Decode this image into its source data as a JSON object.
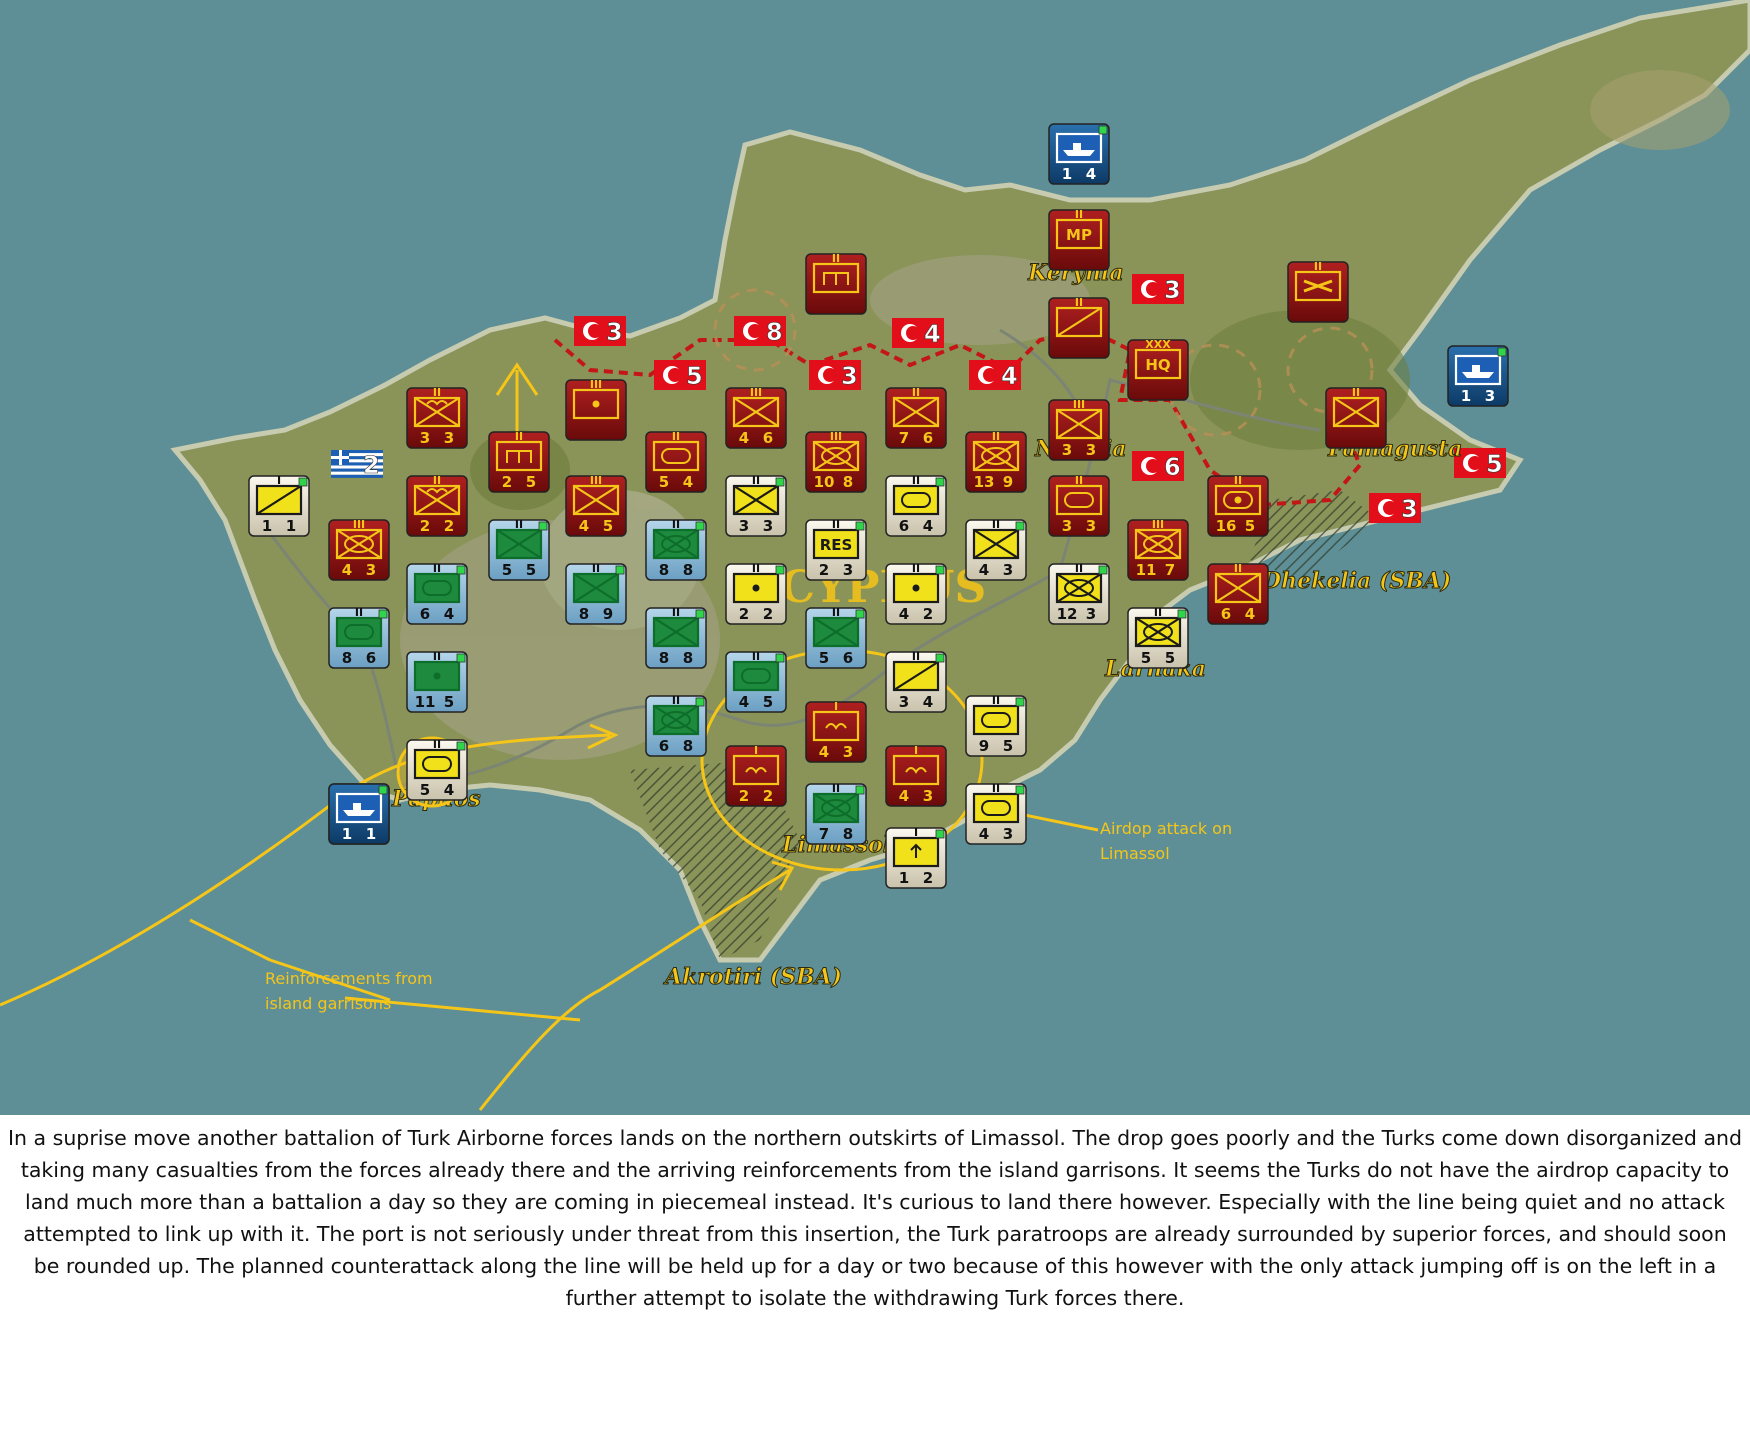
{
  "map": {
    "island_label": "CYPRUS",
    "places": {
      "kyrenia": "Kerynia",
      "nicosia": "Nicosia",
      "famagusta": "Famagusta",
      "dhekelia": "Dhekelia (SBA)",
      "larnaca": "Larnaka",
      "paphos": "Paphos",
      "limassol": "Limassol",
      "akrotiri": "Akrotiri (SBA)"
    },
    "annotations": {
      "airdrop_line1": "Airdop attack on",
      "airdrop_line2": "Limassol",
      "reinf_line1": "Reinforcements from",
      "reinf_line2": "island garrisons"
    },
    "colors": {
      "sea": "#5e8f96",
      "land": "#8a9358",
      "turk_counter": "#8e1010",
      "greek_counter": "#8dbad6",
      "cypriot_counter": "#ece6d4",
      "naval_counter": "#17558e",
      "annotation": "#f5c518",
      "place_label": "#f5c518"
    },
    "flags": [
      {
        "n": "3",
        "icon": "turkish-flag-icon"
      },
      {
        "n": "8",
        "icon": "turkish-flag-icon"
      },
      {
        "n": "4",
        "icon": "turkish-flag-icon"
      },
      {
        "n": "5",
        "icon": "turkish-flag-icon"
      },
      {
        "n": "3",
        "icon": "turkish-flag-icon"
      },
      {
        "n": "4",
        "icon": "turkish-flag-icon"
      },
      {
        "n": "3",
        "icon": "turkish-flag-icon"
      },
      {
        "n": "6",
        "icon": "turkish-flag-icon"
      },
      {
        "n": "5",
        "icon": "turkish-flag-icon"
      },
      {
        "n": "3",
        "icon": "turkish-flag-icon"
      },
      {
        "n": "2",
        "icon": "greek-flag-icon"
      }
    ],
    "units": [
      {
        "side": "turk",
        "size": "II",
        "sym": "MP",
        "a": "",
        "d": ""
      },
      {
        "side": "turk",
        "size": "II",
        "sym": "engineer",
        "a": "",
        "d": ""
      },
      {
        "side": "turk",
        "size": "II",
        "sym": "recon",
        "a": "",
        "d": ""
      },
      {
        "side": "turk",
        "size": "II",
        "sym": "helo",
        "a": "",
        "d": ""
      },
      {
        "side": "turk",
        "size": "XXX",
        "sym": "HQ",
        "a": "",
        "d": ""
      },
      {
        "side": "turk",
        "size": "II",
        "sym": "para-inf",
        "a": "3",
        "d": "3"
      },
      {
        "side": "turk",
        "size": "II",
        "sym": "engineer",
        "a": "2",
        "d": "5"
      },
      {
        "side": "turk",
        "size": "III",
        "sym": "artillery",
        "a": "",
        "d": ""
      },
      {
        "side": "turk",
        "size": "III",
        "sym": "inf",
        "a": "4",
        "d": "6"
      },
      {
        "side": "turk",
        "size": "II",
        "sym": "inf",
        "a": "7",
        "d": "6"
      },
      {
        "side": "turk",
        "size": "III",
        "sym": "inf",
        "a": "3",
        "d": "3"
      },
      {
        "side": "turk",
        "size": "II",
        "sym": "inf",
        "a": "",
        "d": ""
      },
      {
        "side": "turk",
        "size": "II",
        "sym": "para-inf",
        "a": "2",
        "d": "2"
      },
      {
        "side": "turk",
        "size": "II",
        "sym": "armor",
        "a": "5",
        "d": "4"
      },
      {
        "side": "turk",
        "size": "III",
        "sym": "mech-inf",
        "a": "10",
        "d": "8"
      },
      {
        "side": "turk",
        "size": "II",
        "sym": "mech-inf",
        "a": "13",
        "d": "9"
      },
      {
        "side": "turk",
        "size": "II",
        "sym": "armor",
        "a": "3",
        "d": "3"
      },
      {
        "side": "turk",
        "size": "III",
        "sym": "mech-inf",
        "a": "11",
        "d": "7"
      },
      {
        "side": "turk",
        "size": "II",
        "sym": "arty-sp",
        "a": "16",
        "d": "5"
      },
      {
        "side": "turk",
        "size": "III",
        "sym": "mech-inf",
        "a": "4",
        "d": "3"
      },
      {
        "side": "turk",
        "size": "III",
        "sym": "inf",
        "a": "4",
        "d": "5"
      },
      {
        "side": "turk",
        "size": "II",
        "sym": "inf",
        "a": "6",
        "d": "4"
      },
      {
        "side": "turk",
        "size": "I",
        "sym": "airborne",
        "a": "4",
        "d": "3"
      },
      {
        "side": "turk",
        "size": "I",
        "sym": "airborne",
        "a": "2",
        "d": "2"
      },
      {
        "side": "turk",
        "size": "I",
        "sym": "airborne",
        "a": "4",
        "d": "3"
      },
      {
        "side": "greek",
        "size": "II",
        "sym": "inf",
        "a": "5",
        "d": "5"
      },
      {
        "side": "greek",
        "size": "II",
        "sym": "armor",
        "a": "6",
        "d": "4"
      },
      {
        "side": "greek",
        "size": "II",
        "sym": "armor",
        "a": "8",
        "d": "6"
      },
      {
        "side": "greek",
        "size": "II",
        "sym": "artillery",
        "a": "11",
        "d": "5"
      },
      {
        "side": "greek",
        "size": "II",
        "sym": "inf",
        "a": "8",
        "d": "9"
      },
      {
        "side": "greek",
        "size": "II",
        "sym": "mech-inf",
        "a": "8",
        "d": "8"
      },
      {
        "side": "greek",
        "size": "II",
        "sym": "inf",
        "a": "8",
        "d": "8"
      },
      {
        "side": "greek",
        "size": "II",
        "sym": "mech-inf",
        "a": "6",
        "d": "8"
      },
      {
        "side": "greek",
        "size": "II",
        "sym": "inf",
        "a": "5",
        "d": "6"
      },
      {
        "side": "greek",
        "size": "II",
        "sym": "armor",
        "a": "4",
        "d": "5"
      },
      {
        "side": "greek",
        "size": "II",
        "sym": "mech-inf",
        "a": "7",
        "d": "8"
      },
      {
        "side": "cypriot",
        "size": "I",
        "sym": "recon",
        "a": "1",
        "d": "1"
      },
      {
        "side": "cypriot",
        "size": "II",
        "sym": "inf",
        "a": "3",
        "d": "3"
      },
      {
        "side": "cypriot",
        "size": "II",
        "sym": "RES",
        "a": "2",
        "d": "3"
      },
      {
        "side": "cypriot",
        "size": "II",
        "sym": "armor",
        "a": "6",
        "d": "4"
      },
      {
        "side": "cypriot",
        "size": "II",
        "sym": "artillery",
        "a": "2",
        "d": "2"
      },
      {
        "side": "cypriot",
        "size": "II",
        "sym": "artillery",
        "a": "4",
        "d": "2"
      },
      {
        "side": "cypriot",
        "size": "II",
        "sym": "inf",
        "a": "4",
        "d": "3"
      },
      {
        "side": "cypriot",
        "size": "II",
        "sym": "mech-inf",
        "a": "12",
        "d": "3"
      },
      {
        "side": "cypriot",
        "size": "II",
        "sym": "mech-inf",
        "a": "5",
        "d": "5"
      },
      {
        "side": "cypriot",
        "size": "II",
        "sym": "recon",
        "a": "3",
        "d": "4"
      },
      {
        "side": "cypriot",
        "size": "II",
        "sym": "armor",
        "a": "9",
        "d": "5"
      },
      {
        "side": "cypriot",
        "size": "II",
        "sym": "armor",
        "a": "4",
        "d": "3"
      },
      {
        "side": "cypriot",
        "size": "I",
        "sym": "mortar",
        "a": "1",
        "d": "2"
      },
      {
        "side": "cypriot",
        "size": "",
        "sym": "naval",
        "a": "1",
        "d": "1"
      },
      {
        "side": "cypriot",
        "size": "II",
        "sym": "armor",
        "a": "5",
        "d": "4"
      },
      {
        "side": "naval",
        "size": "",
        "sym": "ship",
        "a": "1",
        "d": "4"
      },
      {
        "side": "naval",
        "size": "",
        "sym": "ship",
        "a": "1",
        "d": "3"
      },
      {
        "side": "naval",
        "size": "",
        "sym": "ship",
        "a": "1",
        "d": "1"
      }
    ]
  },
  "caption": "In a suprise move another battalion of Turk Airborne forces lands on the northern outskirts of Limassol. The drop goes poorly and the Turks come down disorganized and taking many casualties from the forces already there and the arriving reinforcements from the island garrisons. It seems the Turks do not have the airdrop capacity to land much more than a battalion a day so they are coming in piecemeal instead. It's curious to land there however. Especially with the line being quiet and no attack attempted to link up with it. The port is not seriously under threat from this insertion, the Turk paratroops are already surrounded by superior forces, and should soon be rounded up. The planned counterattack along the line will be held up for a day or two because of this however with the only attack jumping off is on the left in a further attempt to isolate the withdrawing Turk forces there."
}
